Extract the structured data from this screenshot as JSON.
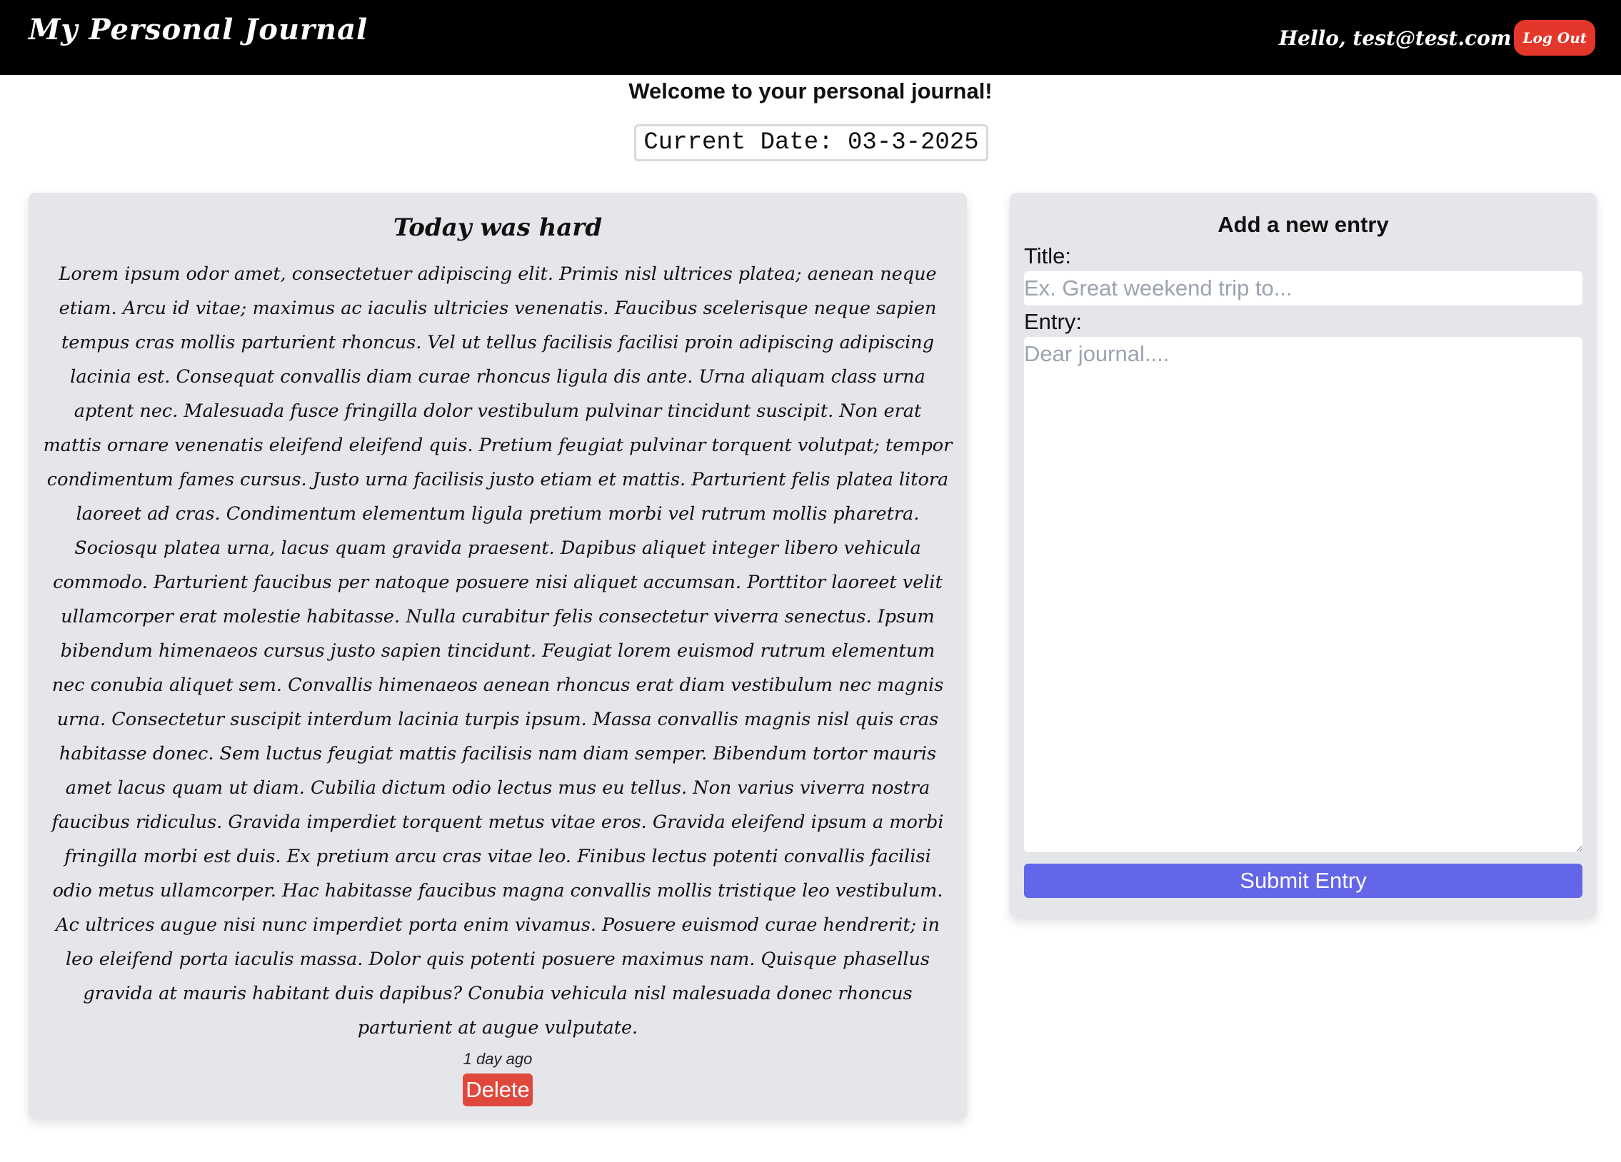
{
  "nav": {
    "brand": "My Personal Journal",
    "greeting": "Hello, test@test.com",
    "logout_label": "Log Out"
  },
  "welcome": "Welcome to your personal journal!",
  "current_date": "Current Date: 03-3-2025",
  "entry": {
    "title": "Today was hard",
    "body": "Lorem ipsum odor amet, consectetuer adipiscing elit. Primis nisl ultrices platea; aenean neque etiam. Arcu id vitae; maximus ac iaculis ultricies venenatis. Faucibus scelerisque neque sapien tempus cras mollis parturient rhoncus. Vel ut tellus facilisis facilisi proin adipiscing adipiscing lacinia est. Consequat convallis diam curae rhoncus ligula dis ante. Urna aliquam class urna aptent nec. Malesuada fusce fringilla dolor vestibulum pulvinar tincidunt suscipit. Non erat mattis ornare venenatis eleifend eleifend quis. Pretium feugiat pulvinar torquent volutpat; tempor condimentum fames cursus. Justo urna facilisis justo etiam et mattis. Parturient felis platea litora laoreet ad cras. Condimentum elementum ligula pretium morbi vel rutrum mollis pharetra. Sociosqu platea urna, lacus quam gravida praesent. Dapibus aliquet integer libero vehicula commodo. Parturient faucibus per natoque posuere nisi aliquet accumsan. Porttitor laoreet velit ullamcorper erat molestie habitasse. Nulla curabitur felis consectetur viverra senectus. Ipsum bibendum himenaeos cursus justo sapien tincidunt. Feugiat lorem euismod rutrum elementum nec conubia aliquet sem. Convallis himenaeos aenean rhoncus erat diam vestibulum nec magnis urna. Consectetur suscipit interdum lacinia turpis ipsum. Massa convallis magnis nisl quis cras habitasse donec. Sem luctus feugiat mattis facilisis nam diam semper. Bibendum tortor mauris amet lacus quam ut diam. Cubilia dictum odio lectus mus eu tellus. Non varius viverra nostra faucibus ridiculus. Gravida imperdiet torquent metus vitae eros. Gravida eleifend ipsum a morbi fringilla morbi est duis. Ex pretium arcu cras vitae leo. Finibus lectus potenti convallis facilisi odio metus ullamcorper. Hac habitasse faucibus magna convallis mollis tristique leo vestibulum. Ac ultrices augue nisi nunc imperdiet porta enim vivamus. Posuere euismod curae hendrerit; in leo eleifend porta iaculis massa. Dolor quis potenti posuere maximus nam. Quisque phasellus gravida at mauris habitant duis dapibus? Conubia vehicula nisl malesuada donec rhoncus parturient at augue vulputate.",
    "timestamp": "1 day ago",
    "delete_label": "Delete"
  },
  "new_entry": {
    "heading": "Add a new entry",
    "title_label": "Title:",
    "title_placeholder": "Ex. Great weekend trip to...",
    "title_value": "",
    "entry_label": "Entry:",
    "entry_placeholder": "Dear journal....",
    "entry_value": "",
    "submit_label": "Submit Entry"
  },
  "colors": {
    "navbar": "#000000",
    "logout": "#e5362b",
    "card": "#e5e6ea",
    "delete": "#e0483e",
    "submit": "#6366e8"
  }
}
